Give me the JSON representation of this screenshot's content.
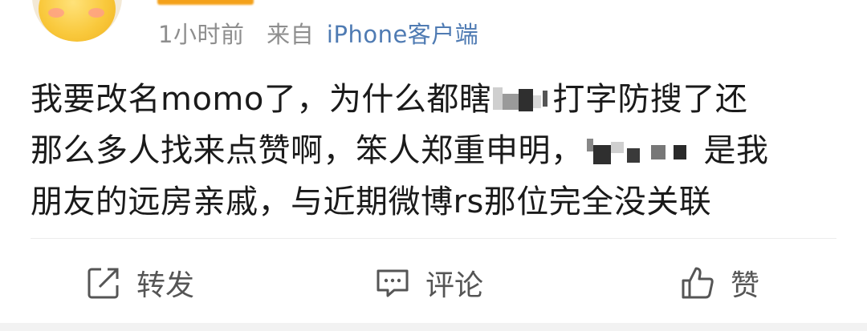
{
  "post": {
    "time": "1小时前",
    "source_label": "来自",
    "device": "iPhone客户端",
    "content": {
      "line1_a": "我要改名momo了，为什么都瞎",
      "line1_b": "打字防搜了还",
      "line2_a": "那么多人找来点赞啊，笨人郑重申明，",
      "line2_b": "是我",
      "line3": "朋友的远房亲戚，与近期微博rs那位完全没关联"
    }
  },
  "actions": {
    "repost": {
      "label": "转发",
      "icon": "share-icon"
    },
    "comment": {
      "label": "评论",
      "icon": "comment-icon"
    },
    "like": {
      "label": "赞",
      "icon": "thumbs-up-icon"
    }
  }
}
